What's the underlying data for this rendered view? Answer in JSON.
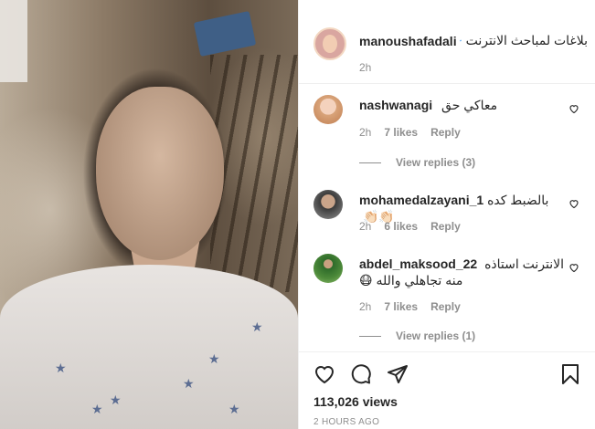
{
  "post": {
    "author": "manoushafadali",
    "verified": true,
    "caption": "بلاغات لمباحث الانترنت",
    "time": "2h",
    "views": "113,026 views",
    "posted_ago": "2 HOURS AGO"
  },
  "comments": [
    {
      "username": "nashwanagi",
      "text": "معاكي حق",
      "time": "2h",
      "likes": "7 likes",
      "reply_label": "Reply",
      "view_replies": "View replies (3)"
    },
    {
      "username": "mohamedalzayani_1",
      "text": "بالضبط كده 👏🏻👏🏻",
      "time": "2h",
      "likes": "6 likes",
      "reply_label": "Reply"
    },
    {
      "username": "abdel_maksood_22",
      "text_line1": "الانترنت استاذه",
      "text_line2": "منه تجاهلي والله 😷",
      "time": "2h",
      "likes": "7 likes",
      "reply_label": "Reply",
      "view_replies": "View replies (1)"
    }
  ],
  "icons": {
    "like": "heart-icon",
    "comment": "comment-icon",
    "share": "share-icon",
    "save": "bookmark-icon",
    "verified": "verified-badge-icon"
  },
  "colors": {
    "verified_blue": "#3897f0",
    "muted_text": "#8e8e8e",
    "primary_text": "#262626"
  }
}
